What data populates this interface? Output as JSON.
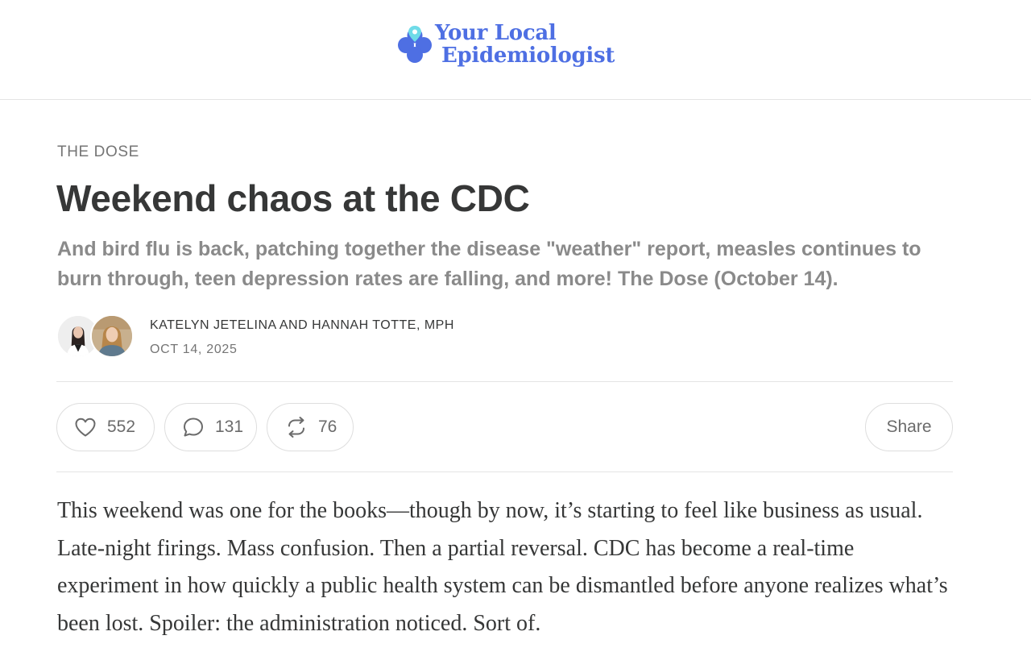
{
  "header": {
    "brand_line1": "Your Local",
    "brand_line2": "Epidemiologist",
    "brand_color": "#4e6fe3",
    "logo_icon": "clover-pin-logo"
  },
  "article": {
    "section": "THE DOSE",
    "title": "Weekend chaos at the CDC",
    "subtitle": "And bird flu is back, patching together the disease \"weather\" report, measles continues to burn through, teen depression rates are falling, and more! The Dose (October 14).",
    "authors": "KATELYN JETELINA AND HANNAH TOTTE, MPH",
    "date": "OCT 14, 2025",
    "body": "This weekend was one for the books—though by now, it’s starting to feel like business as usual. Late-night firings. Mass confusion. Then a partial reversal. CDC has become a real-time experiment in how quickly a public health system can be dismantled before anyone realizes what’s been lost. Spoiler: the administration noticed. Sort of."
  },
  "actions": {
    "likes": "552",
    "comments": "131",
    "restacks": "76",
    "share_label": "Share",
    "icons": [
      "heart-icon",
      "comment-icon",
      "restack-icon"
    ]
  },
  "colors": {
    "text": "#363737",
    "muted": "#757575",
    "subtitle": "#8a8a8a",
    "border": "#e4e4e4"
  }
}
